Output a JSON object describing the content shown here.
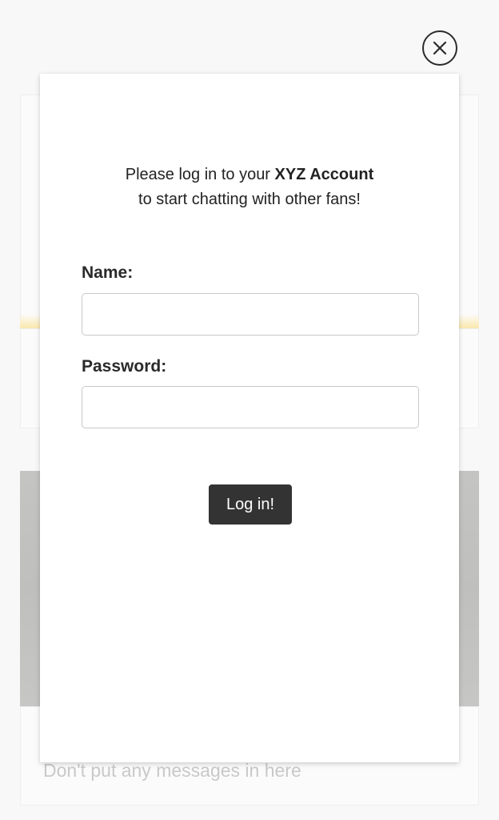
{
  "modal": {
    "intro_prefix": "Please log in to your ",
    "intro_brand": "XYZ Account",
    "intro_line2": "to start chatting with other fans!",
    "name_label": "Name:",
    "name_value": "",
    "password_label": "Password:",
    "password_value": "",
    "login_label": "Log in!"
  },
  "background": {
    "message_placeholder": "Don't put any messages in here"
  },
  "icons": {
    "close": "close-icon"
  },
  "colors": {
    "button_bg": "#333333",
    "modal_bg": "#ffffff",
    "accent_glow": "#f9e7ad"
  }
}
